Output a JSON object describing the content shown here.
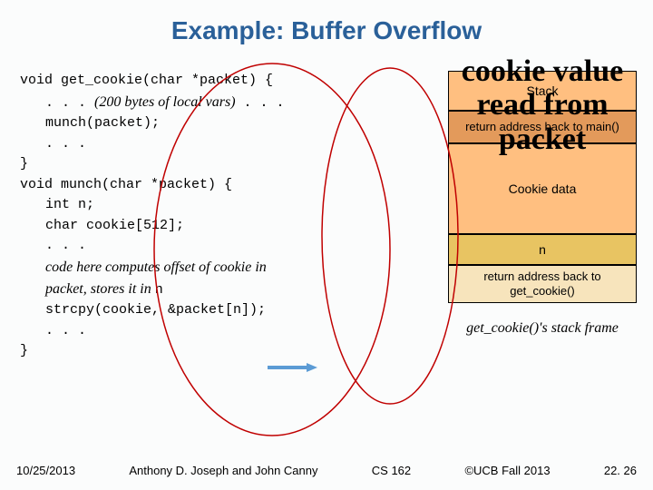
{
  "title": "Example: Buffer Overflow",
  "code": {
    "l1": "void get_cookie(char *packet) {",
    "l2a": ". . . ",
    "l2b": "(200 bytes of local vars)",
    "l2c": " . . .",
    "l3": "munch(packet);",
    "l4": ". . .",
    "l5": "}",
    "l6": "void munch(char *packet) {",
    "l7": "int n;",
    "l8": "char cookie[512];",
    "l9": ". . .",
    "l10a": "code here computes offset of cookie in",
    "l10b": "packet, stores it in ",
    "l10c": "n",
    "l11": "strcpy(cookie, &packet[n]);",
    "l12": ". . .",
    "l13": "}"
  },
  "stack": {
    "label": "Stack",
    "ret_main": "return address back to main()",
    "cookie_data": "Cookie data",
    "n": "n",
    "ret_get": "return address back to get_cookie()",
    "frame": "get_cookie()'s stack frame"
  },
  "overlay": "cookie value read from packet",
  "footer": {
    "date": "10/25/2013",
    "authors": "Anthony D. Joseph and John Canny",
    "course": "CS 162",
    "copyright": "©UCB Fall 2013",
    "slide": "22. 26"
  }
}
